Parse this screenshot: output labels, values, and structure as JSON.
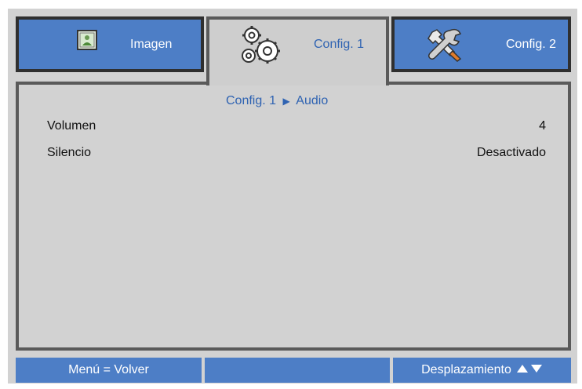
{
  "tabs": [
    {
      "label": "Imagen",
      "icon": "image-icon"
    },
    {
      "label": "Config. 1",
      "icon": "gears-icon"
    },
    {
      "label": "Config. 2",
      "icon": "tools-icon"
    }
  ],
  "breadcrumb": {
    "parent": "Config. 1",
    "current": "Audio"
  },
  "settings": [
    {
      "label": "Volumen",
      "value": "4"
    },
    {
      "label": "Silencio",
      "value": "Desactivado"
    }
  ],
  "footer": {
    "back": "Menú = Volver",
    "middle": "",
    "scroll": "Desplazamiento"
  },
  "colors": {
    "tab_blue": "#4d7ec6",
    "panel_gray": "#d2d2d2",
    "accent_text": "#2f63b2"
  }
}
